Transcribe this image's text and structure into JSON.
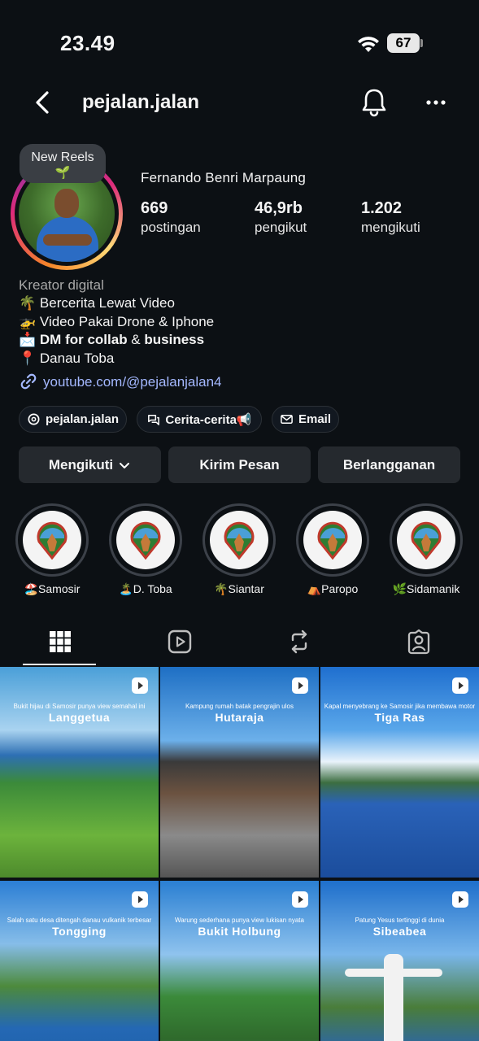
{
  "status_bar": {
    "time": "23.49",
    "battery": "67"
  },
  "nav": {
    "username": "pejalan.jalan"
  },
  "profile": {
    "new_reels_label": "New Reels",
    "new_reels_emoji": "🌱",
    "full_name": "Fernando Benri Marpaung",
    "stats": [
      {
        "value": "669",
        "label": "postingan"
      },
      {
        "value": "46,9rb",
        "label": "pengikut"
      },
      {
        "value": "1.202",
        "label": "mengikuti"
      }
    ],
    "category": "Kreator digital",
    "bio_lines": [
      {
        "emoji": "🌴",
        "text": "Bercerita Lewat Video"
      },
      {
        "emoji": "🚁",
        "text": "Video Pakai Drone & Iphone"
      },
      {
        "emoji": "📩",
        "text_bold_1": "DM for collab",
        "text_mid": " & ",
        "text_bold_2": "business"
      },
      {
        "emoji": "📍",
        "text": "Danau Toba"
      }
    ],
    "link": "youtube.com/@pejalanjalan4"
  },
  "chips": [
    {
      "label": "pejalan.jalan",
      "icon": "threads-icon"
    },
    {
      "label": "Cerita-cerita📢",
      "icon": "chat-bubbles-icon"
    },
    {
      "label": "Email",
      "icon": "mail-icon"
    }
  ],
  "actions": {
    "follow": "Mengikuti",
    "message": "Kirim Pesan",
    "subscribe": "Berlangganan"
  },
  "highlights": [
    {
      "label": "🏖️Samosir"
    },
    {
      "label": "🏝️D. Toba"
    },
    {
      "label": "🌴Siantar"
    },
    {
      "label": "⛺Paropo"
    },
    {
      "label": "🌿Sidamanik"
    }
  ],
  "tabs": [
    "grid-icon",
    "reels-icon",
    "repost-icon",
    "tagged-icon"
  ],
  "posts": [
    {
      "subtitle": "Bukit hijau di Samosir punya view semahal ini",
      "title": "Langgetua"
    },
    {
      "subtitle": "Kampung rumah batak pengrajin ulos",
      "title": "Hutaraja"
    },
    {
      "subtitle": "Kapal menyebrang ke Samosir jika membawa motor",
      "title": "Tiga Ras"
    },
    {
      "subtitle": "Salah satu desa ditengah danau vulkanik terbesar",
      "title": "Tongging"
    },
    {
      "subtitle": "Warung sederhana punya view lukisan nyata",
      "title": "Bukit Holbung"
    },
    {
      "subtitle": "Patung Yesus tertinggi di dunia",
      "title": "Sibeabea"
    }
  ],
  "colors": {
    "background": "#0c1014",
    "button": "#25292e",
    "link": "#a4b8ff",
    "muted": "#a8a8a8"
  }
}
